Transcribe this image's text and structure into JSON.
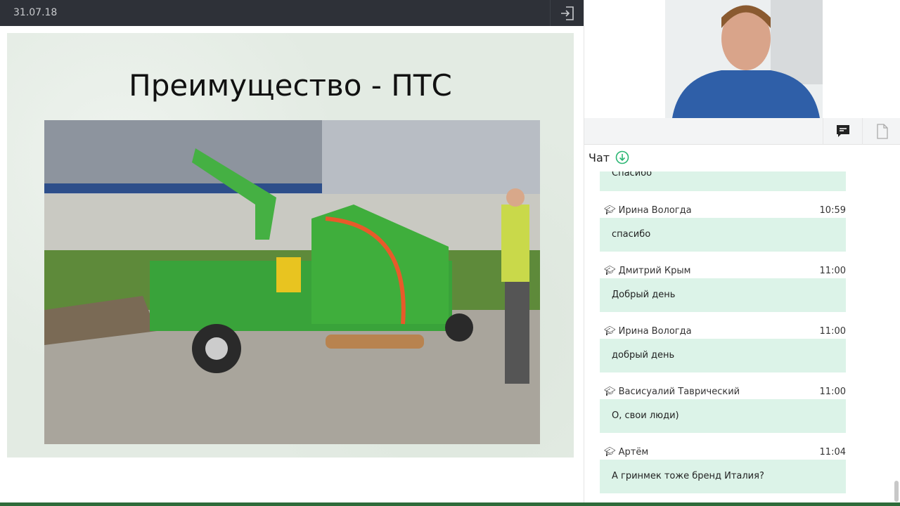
{
  "header": {
    "date": "31.07.18",
    "exit_icon": "exit-icon"
  },
  "slide": {
    "title": "Преимущество - ПТС",
    "image": "wood chipper photo"
  },
  "sidebar": {
    "tabs": [
      {
        "icon": "chat-icon"
      },
      {
        "icon": "document-icon"
      }
    ],
    "chat_title": "Чат"
  },
  "chat": {
    "partial_message": "Спасибо",
    "messages": [
      {
        "author": "Ирина Вологда",
        "time": "10:59",
        "text": "спасибо"
      },
      {
        "author": "Дмитрий Крым",
        "time": "11:00",
        "text": "Добрый день"
      },
      {
        "author": "Ирина Вологда",
        "time": "11:00",
        "text": "добрый день"
      },
      {
        "author": "Васисуалий Таврический",
        "time": "11:00",
        "text": "О, свои люди)"
      },
      {
        "author": "Артём",
        "time": "11:04",
        "text": "А гринмек тоже бренд Италия?"
      }
    ]
  },
  "colors": {
    "accent": "#2bb673",
    "bubble": "#dcf3e8",
    "topbar": "#2e3138"
  }
}
